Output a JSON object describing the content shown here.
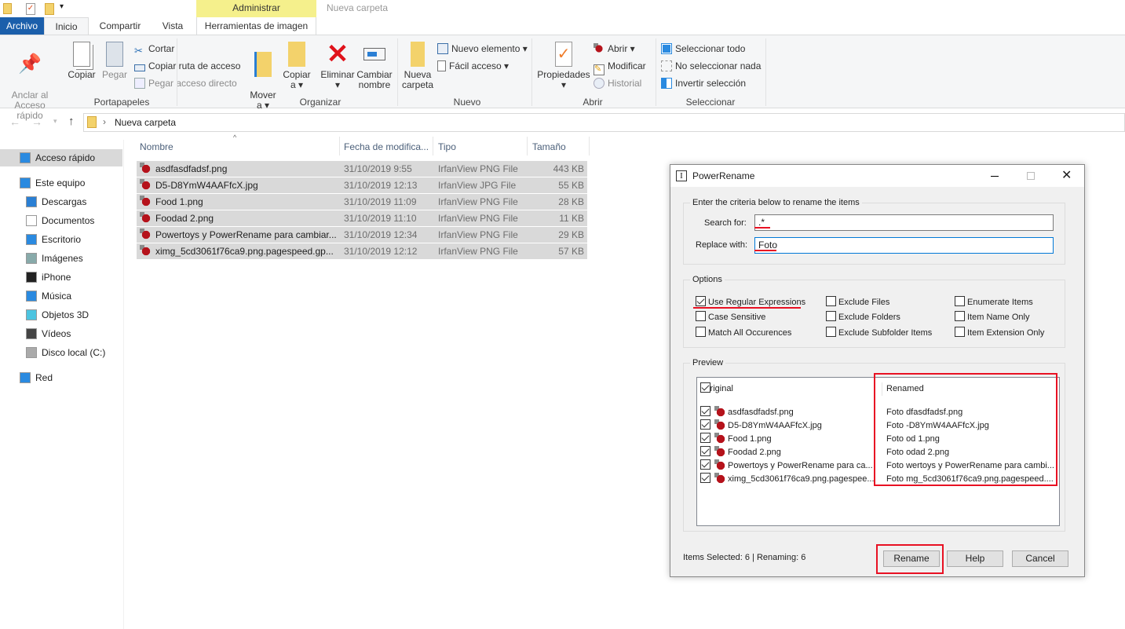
{
  "window": {
    "title": "Nueva carpeta",
    "contextual_tab_header": "Administrar"
  },
  "tabs": [
    {
      "label": "Archivo"
    },
    {
      "label": "Inicio"
    },
    {
      "label": "Compartir"
    },
    {
      "label": "Vista"
    },
    {
      "label": "Herramientas de imagen"
    }
  ],
  "ribbon": {
    "portapapeles": {
      "label": "Portapapeles",
      "anclar": "Anclar al\nAcceso rápido",
      "copiar": "Copiar",
      "pegar": "Pegar",
      "cortar": "Cortar",
      "copiar_ruta": "Copiar ruta de acceso",
      "pegar_acceso": "Pegar acceso directo"
    },
    "organizar": {
      "label": "Organizar",
      "mover": "Mover\na ▾",
      "copiar_a": "Copiar\na ▾",
      "eliminar": "Eliminar\n▾",
      "cambiar": "Cambiar\nnombre"
    },
    "nuevo": {
      "label": "Nuevo",
      "nueva_carpeta": "Nueva\ncarpeta",
      "nuevo_elemento": "Nuevo elemento ▾",
      "facil_acceso": "Fácil acceso ▾"
    },
    "abrir": {
      "label": "Abrir",
      "propiedades": "Propiedades\n▾",
      "abrir": "Abrir ▾",
      "modificar": "Modificar",
      "historial": "Historial"
    },
    "seleccionar": {
      "label": "Seleccionar",
      "todo": "Seleccionar todo",
      "nada": "No seleccionar nada",
      "invertir": "Invertir selección"
    }
  },
  "address": {
    "path": "Nueva carpeta"
  },
  "nav": [
    {
      "label": "Acceso rápido",
      "icon": "star-icon"
    },
    {
      "label": "Este equipo",
      "icon": "computer-icon"
    },
    {
      "label": "Descargas",
      "icon": "download-icon"
    },
    {
      "label": "Documentos",
      "icon": "document-icon"
    },
    {
      "label": "Escritorio",
      "icon": "desktop-icon"
    },
    {
      "label": "Imágenes",
      "icon": "pictures-icon"
    },
    {
      "label": "iPhone",
      "icon": "phone-icon"
    },
    {
      "label": "Música",
      "icon": "music-icon"
    },
    {
      "label": "Objetos 3D",
      "icon": "cube-icon"
    },
    {
      "label": "Vídeos",
      "icon": "video-icon"
    },
    {
      "label": "Disco local (C:)",
      "icon": "drive-icon"
    },
    {
      "label": "Red",
      "icon": "network-icon"
    }
  ],
  "columns": [
    "Nombre",
    "Fecha de modifica...",
    "Tipo",
    "Tamaño"
  ],
  "files": [
    {
      "name": "asdfasdfadsf.png",
      "date": "31/10/2019 9:55",
      "type": "IrfanView PNG File",
      "size": "443 KB"
    },
    {
      "name": "D5-D8YmW4AAFfcX.jpg",
      "date": "31/10/2019 12:13",
      "type": "IrfanView JPG File",
      "size": "55 KB"
    },
    {
      "name": "Food 1.png",
      "date": "31/10/2019 11:09",
      "type": "IrfanView PNG File",
      "size": "28 KB"
    },
    {
      "name": "Foodad 2.png",
      "date": "31/10/2019 11:10",
      "type": "IrfanView PNG File",
      "size": "11 KB"
    },
    {
      "name": "Powertoys y PowerRename para cambiar...",
      "date": "31/10/2019 12:34",
      "type": "IrfanView PNG File",
      "size": "29 KB"
    },
    {
      "name": "ximg_5cd3061f76ca9.png.pagespeed.gp...",
      "date": "31/10/2019 12:12",
      "type": "IrfanView PNG File",
      "size": "57 KB"
    }
  ],
  "dialog": {
    "title": "PowerRename",
    "criteria_legend": "Enter the criteria below to rename the items",
    "search_label": "Search for:",
    "search_value": ".*",
    "replace_label": "Replace with:",
    "replace_value": "Foto",
    "options_legend": "Options",
    "options": [
      {
        "label": "Use Regular Expressions",
        "checked": true
      },
      {
        "label": "Case Sensitive",
        "checked": false
      },
      {
        "label": "Match All Occurences",
        "checked": false
      },
      {
        "label": "Exclude Files",
        "checked": false
      },
      {
        "label": "Exclude Folders",
        "checked": false
      },
      {
        "label": "Exclude Subfolder Items",
        "checked": false
      },
      {
        "label": "Enumerate Items",
        "checked": false
      },
      {
        "label": "Item Name Only",
        "checked": false
      },
      {
        "label": "Item Extension Only",
        "checked": false
      }
    ],
    "preview_legend": "Preview",
    "col_original": "Original",
    "col_renamed": "Renamed",
    "preview": [
      {
        "original": "asdfasdfadsf.png",
        "renamed": "Foto dfasdfadsf.png"
      },
      {
        "original": "D5-D8YmW4AAFfcX.jpg",
        "renamed": "Foto -D8YmW4AAFfcX.jpg"
      },
      {
        "original": "Food 1.png",
        "renamed": "Foto od 1.png"
      },
      {
        "original": "Foodad 2.png",
        "renamed": "Foto odad 2.png"
      },
      {
        "original": "Powertoys y PowerRename para ca...",
        "renamed": "Foto wertoys y PowerRename para cambi..."
      },
      {
        "original": "ximg_5cd3061f76ca9.png.pagespee...",
        "renamed": "Foto mg_5cd3061f76ca9.png.pagespeed...."
      }
    ],
    "status": "Items Selected: 6 | Renaming: 6",
    "rename": "Rename",
    "help": "Help",
    "cancel": "Cancel"
  },
  "colors": {
    "accent": "#1b5fab",
    "highlight": "#e81123",
    "selection": "#d9d9d9",
    "contextual": "#f5f08c"
  }
}
